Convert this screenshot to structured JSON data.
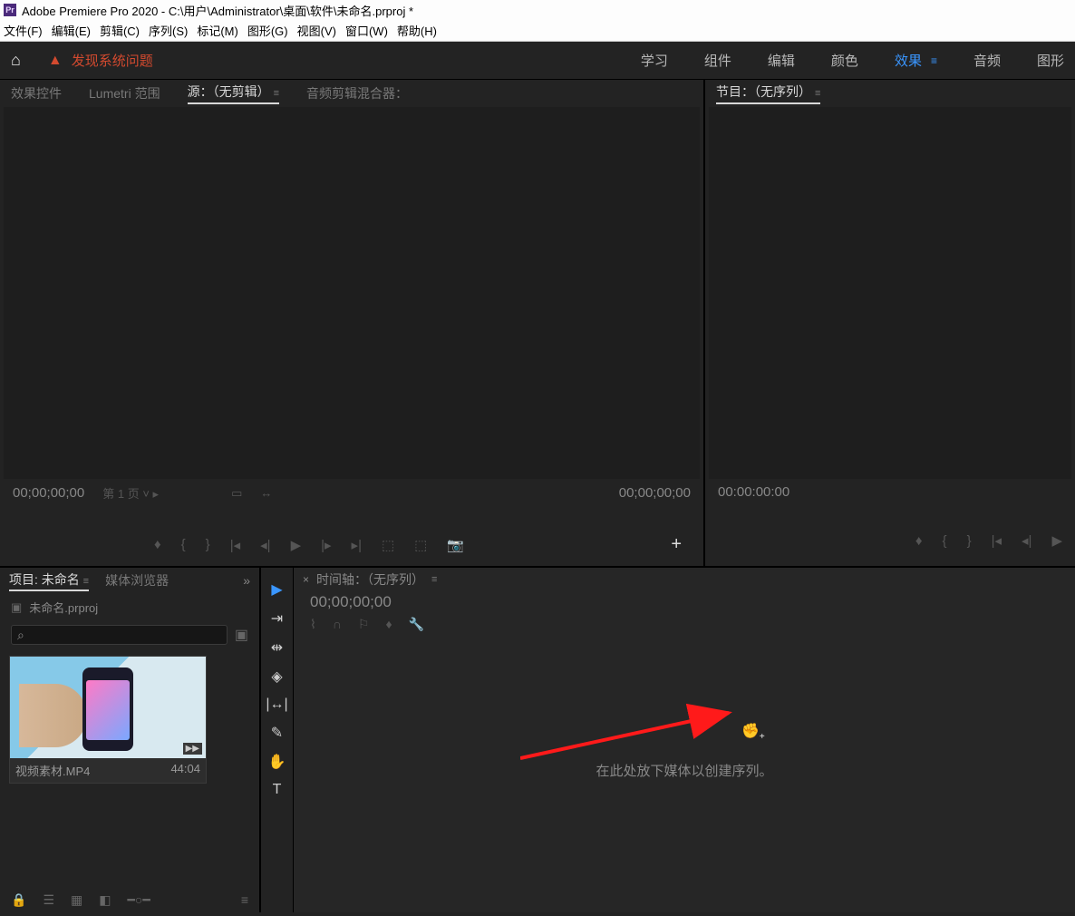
{
  "title_bar": "Adobe Premiere Pro 2020 - C:\\用户\\Administrator\\桌面\\软件\\未命名.prproj *",
  "menu": {
    "file": "文件(F)",
    "edit": "编辑(E)",
    "clip": "剪辑(C)",
    "sequence": "序列(S)",
    "marker": "标记(M)",
    "graphic": "图形(G)",
    "view": "视图(V)",
    "window": "窗口(W)",
    "help": "帮助(H)"
  },
  "header": {
    "warning_text": "发现系统问题"
  },
  "workspaces": {
    "learn": "学习",
    "assembly": "组件",
    "edit": "编辑",
    "color": "颜色",
    "effects": "效果",
    "audio": "音频",
    "graphics": "图形",
    "active": "效果"
  },
  "source_panel": {
    "tabs": {
      "effect_controls": "效果控件",
      "lumetri": "Lumetri 范围",
      "source": "源：（无剪辑）",
      "audio_mixer": "音频剪辑混合器："
    },
    "tc_left": "00;00;00;00",
    "page": "第 1 页",
    "tc_right": "00;00;00;00"
  },
  "program_panel": {
    "title": "节目：（无序列）",
    "tc": "00:00:00:00"
  },
  "project_panel": {
    "tabs": {
      "project": "项目: 未命名",
      "media_browser": "媒体浏览器"
    },
    "filename": "未命名.prproj",
    "search_glyph": "⌕",
    "clip": {
      "name": "视频素材.MP4",
      "duration": "44:04"
    }
  },
  "timeline_panel": {
    "title": "时间轴：（无序列）",
    "tc": "00;00;00;00",
    "drop_hint": "在此处放下媒体以创建序列。"
  }
}
